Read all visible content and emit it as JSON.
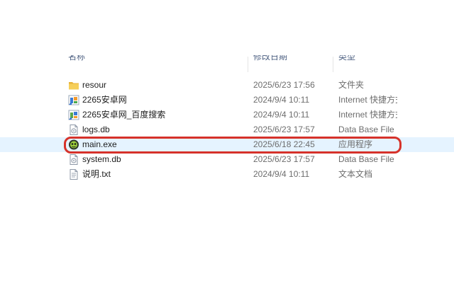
{
  "columns": {
    "name": "名称",
    "date": "修改日期",
    "type": "类型"
  },
  "files": [
    {
      "icon": "folder-icon",
      "name": "resour",
      "date": "2025/6/23 17:56",
      "type": "文件夹"
    },
    {
      "icon": "internet-shortcut-icon",
      "name": "2265安卓网",
      "date": "2024/9/4 10:11",
      "type": "Internet 快捷方式"
    },
    {
      "icon": "internet-shortcut-icon",
      "name": "2265安卓网_百度搜索",
      "date": "2024/9/4 10:11",
      "type": "Internet 快捷方式"
    },
    {
      "icon": "db-file-icon",
      "name": "logs.db",
      "date": "2025/6/23 17:57",
      "type": "Data Base File"
    },
    {
      "icon": "exe-app-icon",
      "name": "main.exe",
      "date": "2025/6/18 22:45",
      "type": "应用程序"
    },
    {
      "icon": "db-file-icon",
      "name": "system.db",
      "date": "2025/6/23 17:57",
      "type": "Data Base File"
    },
    {
      "icon": "text-file-icon",
      "name": "说明.txt",
      "date": "2024/9/4 10:11",
      "type": "文本文档"
    }
  ],
  "colors": {
    "highlight": "#d6322a",
    "selected_row": "#e5f3ff",
    "folder": "#f0c040"
  }
}
